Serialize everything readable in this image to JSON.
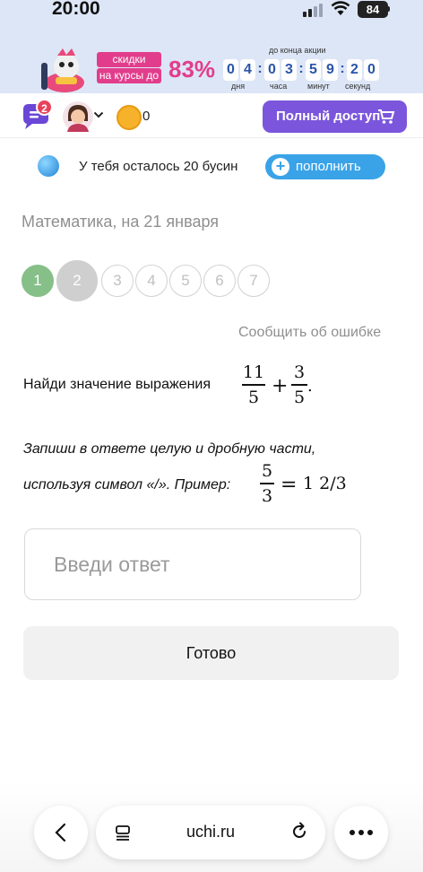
{
  "status_bar": {
    "time": "20:00",
    "battery": "84"
  },
  "promo": {
    "label_line1": "скидки",
    "label_line2": "на курсы до",
    "percent": "83%",
    "until_label": "до конца акции",
    "timer": {
      "days": [
        "0",
        "4"
      ],
      "hours": [
        "0",
        "3"
      ],
      "minutes": [
        "5",
        "9"
      ],
      "seconds": [
        "2",
        "0"
      ]
    },
    "units": {
      "days": "дня",
      "hours": "часа",
      "minutes": "минут",
      "seconds": "секунд"
    },
    "colors": {
      "accent": "#e23d8c",
      "background": "#dde6f6"
    }
  },
  "header": {
    "chat_badge": "2",
    "coins": "0",
    "full_access_label": "Полный доступ",
    "colors": {
      "button": "#7b56dc"
    }
  },
  "beads": {
    "text": "У тебя осталось 20 бусин",
    "refill_label": "пополнить"
  },
  "lesson": {
    "title": "Математика, на 21 января",
    "steps": [
      "1",
      "2",
      "3",
      "4",
      "5",
      "6",
      "7"
    ],
    "current_step": 2,
    "completed_steps": [
      1
    ],
    "report_label": "Сообщить об ошибке"
  },
  "task": {
    "prompt": "Найди значение выражения",
    "expr": {
      "frac1_num": "11",
      "frac1_den": "5",
      "op": "+",
      "frac2_num": "3",
      "frac2_den": "5",
      "end": "."
    },
    "hint_line1": "Запиши в ответе целую и дробную части,",
    "hint_line2": "используя символ «/». Пример:",
    "example": {
      "num": "5",
      "den": "3",
      "eq": "=",
      "result": "1 2/3"
    }
  },
  "answer": {
    "placeholder": "Введи ответ",
    "value": ""
  },
  "submit_label": "Готово",
  "browser": {
    "url": "uchi.ru"
  }
}
